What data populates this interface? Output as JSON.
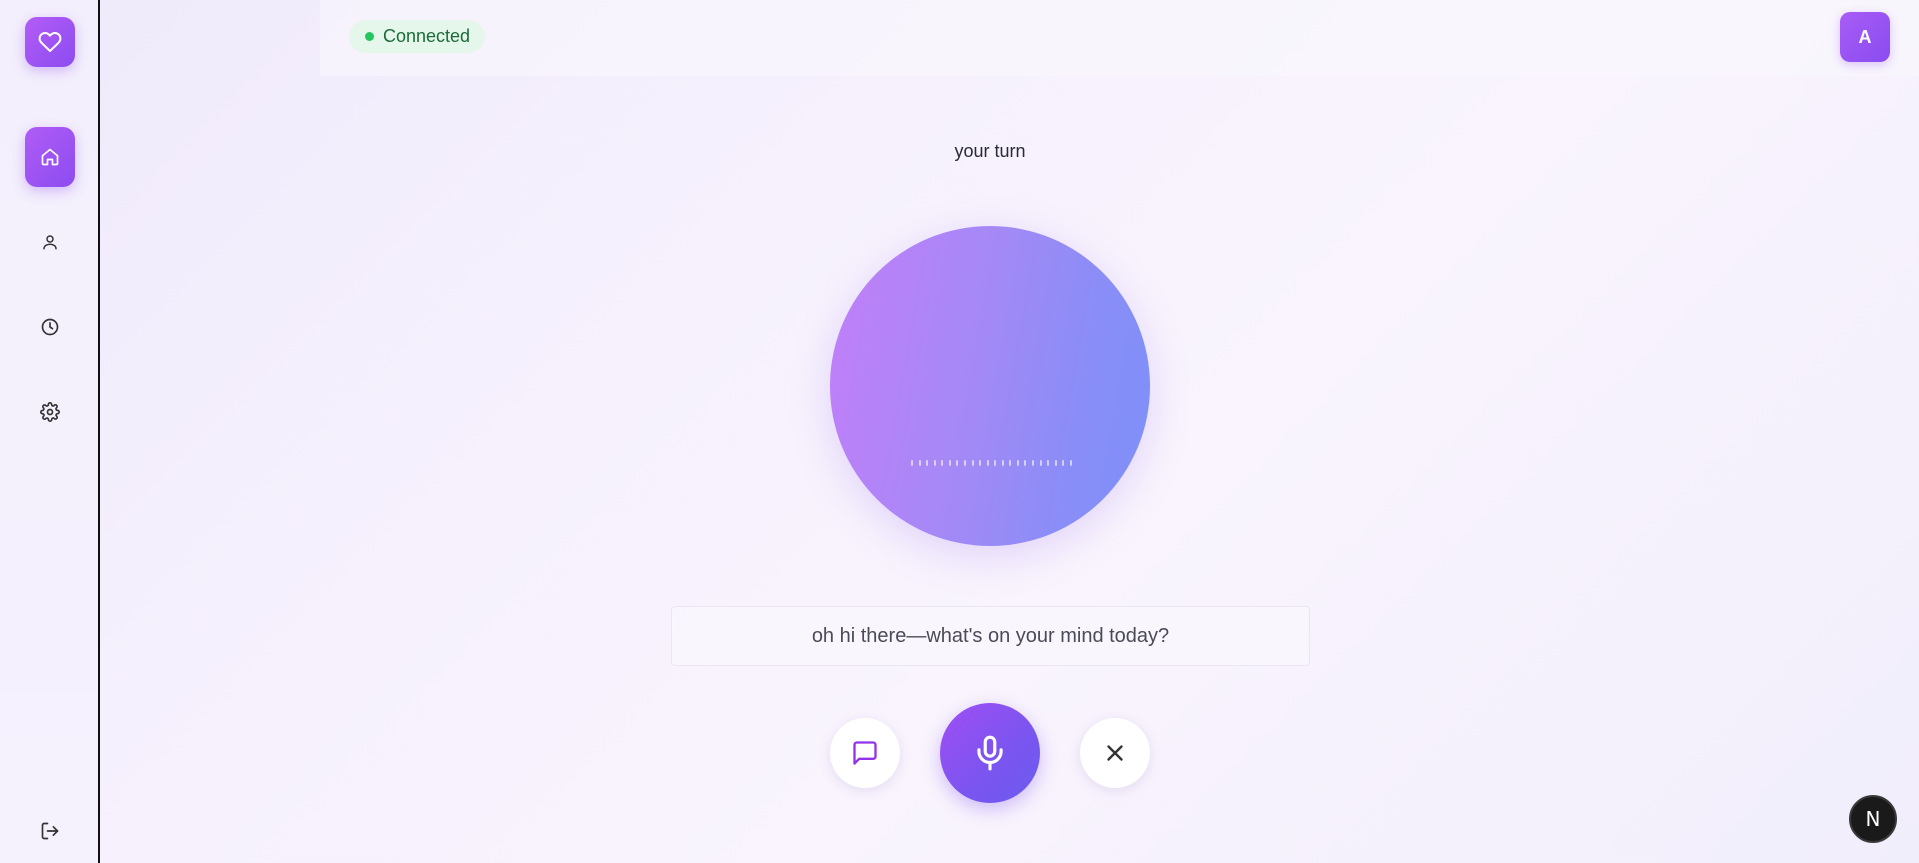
{
  "sidebar": {
    "logo_icon": "heart-icon",
    "items": [
      {
        "name": "home",
        "icon": "home-icon",
        "active": true
      },
      {
        "name": "profile",
        "icon": "user-icon",
        "active": false
      },
      {
        "name": "history",
        "icon": "clock-icon",
        "active": false
      },
      {
        "name": "settings",
        "icon": "gear-icon",
        "active": false
      }
    ],
    "logout_icon": "logout-icon"
  },
  "header": {
    "status_text": "Connected",
    "status_color": "#22c55e",
    "avatar_initial": "A"
  },
  "main": {
    "turn_label": "your turn",
    "message": "oh hi there—what's on your mind today?"
  },
  "controls": {
    "chat_icon": "chat-icon",
    "mic_icon": "microphone-icon",
    "close_icon": "close-icon"
  },
  "dev_badge": {
    "label": "N"
  },
  "colors": {
    "accent": "#9b5cf6",
    "orb_start": "#c27ef8",
    "orb_end": "#7d90f8"
  }
}
